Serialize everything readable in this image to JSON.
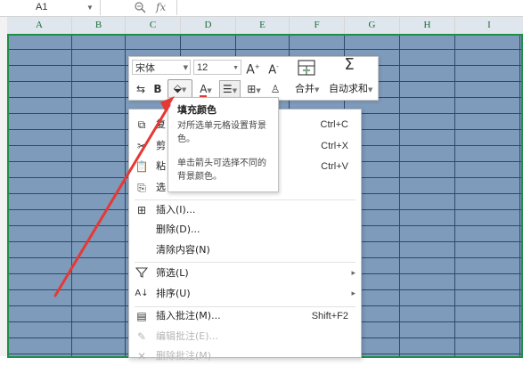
{
  "formula_bar": {
    "cell_ref": "A1",
    "fx": "fx"
  },
  "columns": [
    "A",
    "B",
    "C",
    "D",
    "E",
    "F",
    "G",
    "H",
    "I"
  ],
  "mini_toolbar": {
    "font_name": "宋体",
    "font_size": "12",
    "grow_font": "A",
    "shrink_font": "A",
    "bold": "B",
    "font_color": "A",
    "merge_label": "合并",
    "autosum_label": "自动求和"
  },
  "tooltip": {
    "title": "填充颜色",
    "line1": "对所选单元格设置背景色。",
    "line2": "单击箭头可选择不同的背景颜色。"
  },
  "context_menu": {
    "copy": {
      "label": "复",
      "shortcut": "Ctrl+C"
    },
    "cut": {
      "label": "剪",
      "shortcut": "Ctrl+X"
    },
    "paste": {
      "label": "粘",
      "shortcut": "Ctrl+V"
    },
    "paste_special": {
      "label": "选"
    },
    "insert": {
      "label": "插入(I)..."
    },
    "delete": {
      "label": "删除(D)..."
    },
    "clear": {
      "label": "清除内容(N)"
    },
    "filter": {
      "label": "筛选(L)"
    },
    "sort": {
      "label": "排序(U)"
    },
    "insert_comment": {
      "label": "插入批注(M)...",
      "shortcut": "Shift+F2"
    },
    "edit_comment": {
      "label": "编辑批注(E)..."
    },
    "delete_comment": {
      "label": "删除批注(M)"
    }
  },
  "colors": {
    "cell_fill": "#7f9bbb",
    "grid_line": "#2c4a6c",
    "selection_border": "#1f8f46",
    "annotation_arrow": "#e53935"
  }
}
